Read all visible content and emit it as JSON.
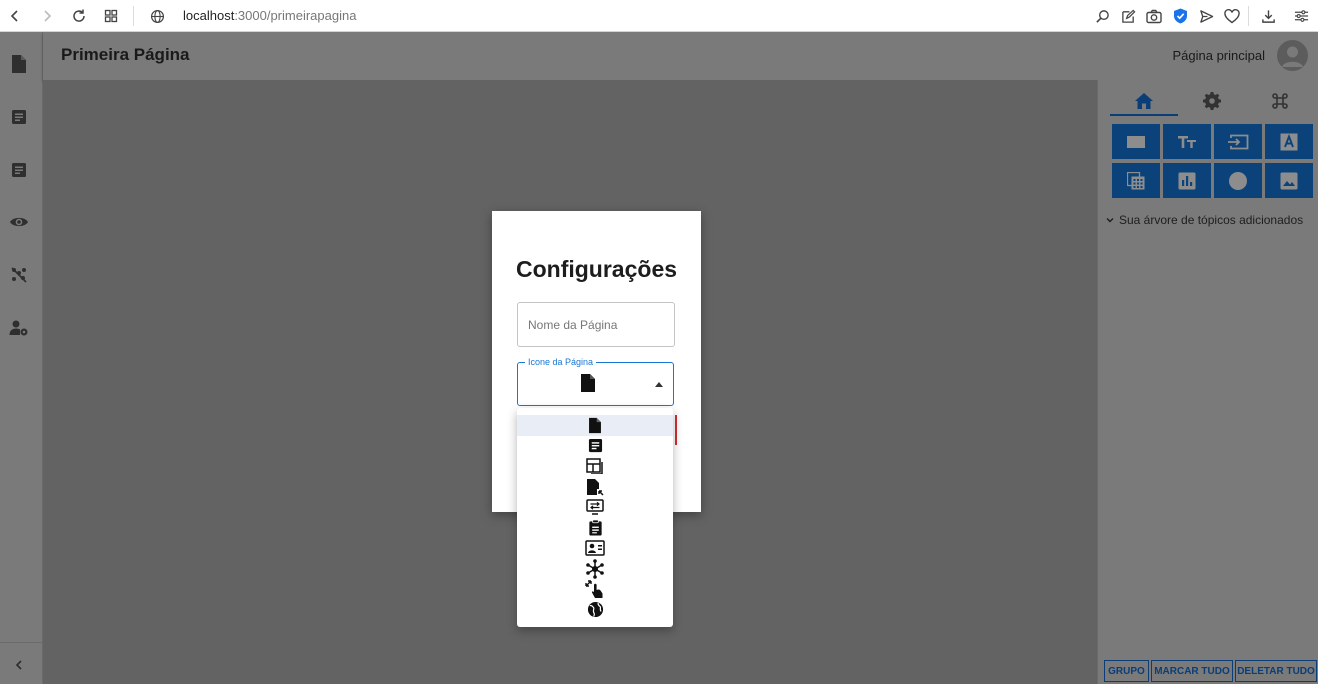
{
  "browser": {
    "url_host": "localhost",
    "url_path": ":3000/primeirapagina",
    "shield_color": "#1a73e8"
  },
  "left_rail": {
    "items": [
      {
        "icon": "file-icon"
      },
      {
        "icon": "article-icon"
      },
      {
        "icon": "article-icon"
      },
      {
        "icon": "eye-icon"
      },
      {
        "icon": "scatter-off-icon"
      },
      {
        "icon": "user-settings-icon"
      }
    ],
    "collapse_icon": "chevron-left-icon"
  },
  "header": {
    "title": "Primeira Página",
    "home_link": "Página principal"
  },
  "right_panel": {
    "tabs": [
      {
        "icon": "home-icon",
        "active": true
      },
      {
        "icon": "gear-icon",
        "active": false
      },
      {
        "icon": "command-icon",
        "active": false
      }
    ],
    "tiles": [
      {
        "icon": "rectangle-icon"
      },
      {
        "icon": "text-size-icon"
      },
      {
        "icon": "input-icon"
      },
      {
        "icon": "font-box-icon"
      },
      {
        "icon": "calculator-grid-icon"
      },
      {
        "icon": "bar-chart-icon"
      },
      {
        "icon": "circle-icon"
      },
      {
        "icon": "image-icon"
      }
    ],
    "tree_label": "Sua árvore de tópicos adicionados",
    "buttons": {
      "group": "GRUPO",
      "select_all": "MARCAR TUDO",
      "delete_all": "DELETAR TUDO"
    },
    "accent_color": "#0b427a"
  },
  "modal": {
    "title": "Configurações",
    "name_field": {
      "placeholder": "Nome da Página",
      "value": ""
    },
    "icon_field": {
      "label": "Icone da Página",
      "selected_icon": "file-icon"
    }
  },
  "dropdown": {
    "options": [
      {
        "icon": "file-icon",
        "selected": true
      },
      {
        "icon": "article-icon",
        "selected": false
      },
      {
        "icon": "dashboard-layout-icon",
        "selected": false
      },
      {
        "icon": "file-open-icon",
        "selected": false
      },
      {
        "icon": "swap-screen-icon",
        "selected": false
      },
      {
        "icon": "clipboard-icon",
        "selected": false
      },
      {
        "icon": "contact-card-icon",
        "selected": false
      },
      {
        "icon": "hub-icon",
        "selected": false
      },
      {
        "icon": "touch-expand-icon",
        "selected": false
      },
      {
        "icon": "globe-icon",
        "selected": false
      }
    ]
  }
}
